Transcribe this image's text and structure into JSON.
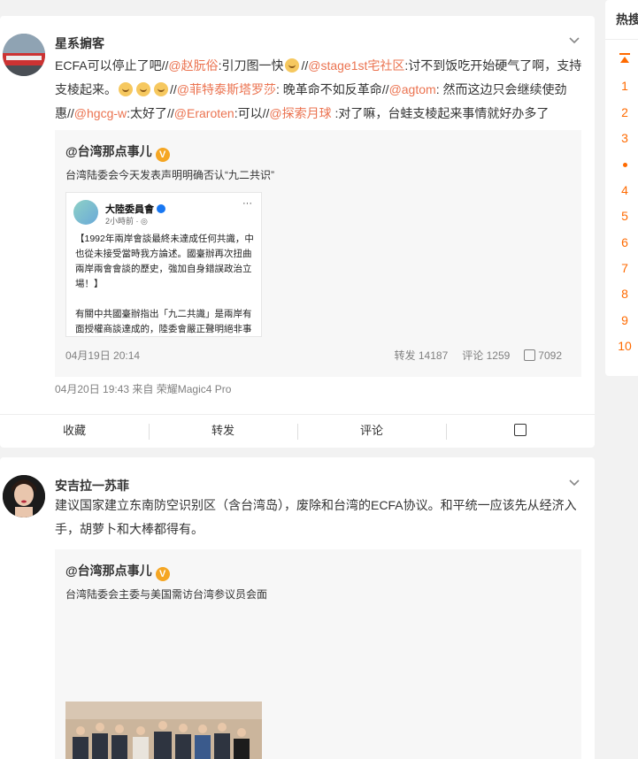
{
  "posts": [
    {
      "username": "星系掮客",
      "text_parts": [
        "ECFA可以停止了吧//",
        "@赵朊俗",
        ":引刀图一快",
        "//",
        "@stage1st宅社区",
        ":讨不到饭吃开始硬气了啊，支持支棱起来。",
        "//",
        "@菲特泰斯塔罗莎",
        ": 晚革命不如反革命//",
        "@agtom",
        ": 然而这边只会继续使劲惠//",
        "@hgcg-w",
        ":太好了//",
        "@Eraroten",
        ":可以//",
        "@探索月球",
        " :对了嘛，台蛙支棱起来事情就好办多了"
      ],
      "repost": {
        "user": "@台湾那点事儿",
        "badge": "V",
        "text": "台湾陆委会今天发表声明明确否认“九二共识”",
        "fb_name": "大陸委員會",
        "fb_time": "2小時前 · ◎",
        "fb_dots": "···",
        "fb_body": "【1992年兩岸會談最終未達成任何共識，中\n也從未接受當時我方論述。國臺辦再次扭曲\n兩岸兩會會談的歷史，強加自身錯誤政治立\n場！】\n\n有關中共國臺辦指出「九二共識」是兩岸有\n面授權商談達成的，陸委會嚴正聲明絕非事\n中共此舉旨是再次混淆臺灣兩岸兩會會談的",
        "date": "04月19日 20:14",
        "repost_label": "转发 14187",
        "comment_label": "评论 1259",
        "like_count": "7092"
      },
      "meta": "04月20日 19:43  来自 荣耀Magic4 Pro",
      "actions": [
        "收藏",
        "转发",
        "评论"
      ]
    },
    {
      "username": "安吉拉一苏菲",
      "text": "建议国家建立东南防空识别区（含台湾岛），废除和台湾的ECFA协议。和平统一应该先从经济入手，胡萝卜和大棒都得有。",
      "repost": {
        "user": "@台湾那点事儿",
        "badge": "V",
        "text": "台湾陆委会主委与美国需访台湾参议员会面"
      }
    }
  ],
  "sidebar": {
    "title": "热搜",
    "numbers": [
      "1",
      "2",
      "3",
      "4",
      "5",
      "6",
      "7",
      "8",
      "9",
      "10"
    ]
  },
  "colors": {
    "accent": "#eb7350",
    "hot": "#ff6a00"
  },
  "icons": [
    "chevron-down-icon",
    "verified-v-icon",
    "like-thumb-icon",
    "pin-top-icon"
  ]
}
